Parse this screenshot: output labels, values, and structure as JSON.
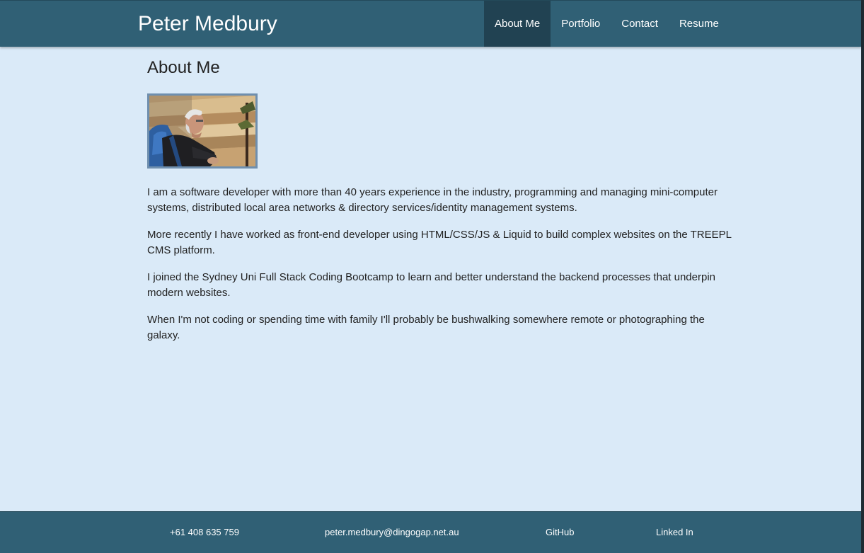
{
  "header": {
    "brand": "Peter Medbury",
    "nav": [
      {
        "label": "About Me",
        "active": true
      },
      {
        "label": "Portfolio",
        "active": false
      },
      {
        "label": "Contact",
        "active": false
      },
      {
        "label": "Resume",
        "active": false
      }
    ]
  },
  "main": {
    "title": "About Me",
    "paragraphs": [
      "I am a software developer with more than 40 years experience in the industry, programming and managing mini-computer systems, distributed local area networks & directory services/identity management systems.",
      "More recently I have worked as front-end developer using HTML/CSS/JS & Liquid to build complex websites on the TREEPL CMS platform.",
      "I joined the Sydney Uni Full Stack Coding Bootcamp to learn and better understand the backend processes that underpin modern websites.",
      "When I'm not coding or spending time with family I'll probably be bushwalking somewhere remote or photographing the galaxy."
    ]
  },
  "footer": {
    "phone": "+61 408 635 759",
    "email": "peter.medbury@dingogap.net.au",
    "github": "GitHub",
    "linkedin": "Linked In"
  },
  "colors": {
    "header_bg": "#306075",
    "active_nav_bg": "#214252",
    "page_bg": "#daeaf8",
    "photo_border": "#6f8fae"
  }
}
